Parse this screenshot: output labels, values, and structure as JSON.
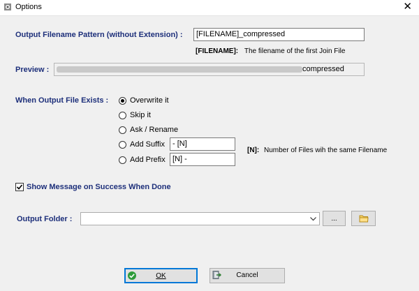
{
  "window": {
    "title": "Options",
    "close_glyph": "✕"
  },
  "output_pattern": {
    "label": "Output Filename Pattern (without Extension) :",
    "value": "[FILENAME]_compressed"
  },
  "filename_note": {
    "key": "[FILENAME]:",
    "text": "The filename of the first Join File"
  },
  "preview": {
    "label": "Preview :",
    "value": "compressed"
  },
  "when_exists": {
    "label": "When Output File Exists  :",
    "options": [
      {
        "label": "Overwrite it",
        "selected": true
      },
      {
        "label": "Skip it",
        "selected": false
      },
      {
        "label": "Ask / Rename",
        "selected": false
      },
      {
        "label": "Add Suffix",
        "selected": false,
        "value": "- [N]"
      },
      {
        "label": "Add Prefix",
        "selected": false,
        "value": "[N] -"
      }
    ]
  },
  "n_note": {
    "key": "[N]:",
    "text": "Number of Files wih the same Filename"
  },
  "show_message": {
    "label": "Show Message on Success When Done",
    "checked": true
  },
  "output_folder": {
    "label": "Output Folder :",
    "value": "",
    "browse_label": "...",
    "folder_icon": "folder-icon"
  },
  "buttons": {
    "ok": "OK",
    "cancel": "Cancel"
  }
}
